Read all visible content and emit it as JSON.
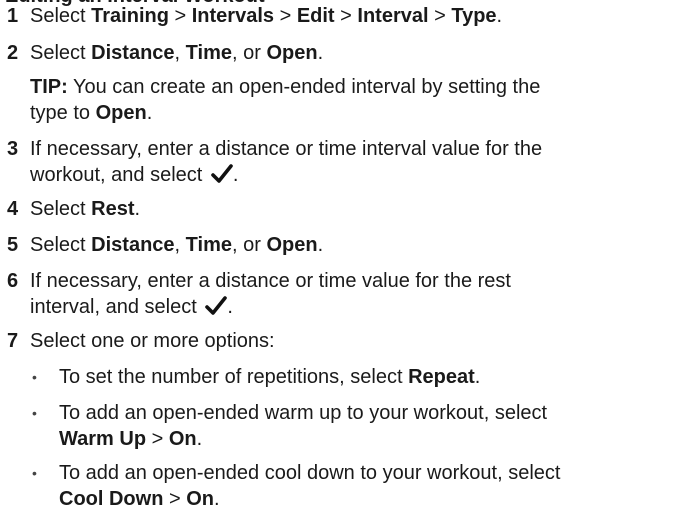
{
  "heading_partial": "Editing an Interval Workout",
  "steps": [
    {
      "num": "1",
      "lines": [
        [
          "Select ",
          {
            "b": "Training"
          },
          " > ",
          {
            "b": "Intervals"
          },
          " > ",
          {
            "b": "Edit"
          },
          " > ",
          {
            "b": "Interval"
          },
          " > ",
          {
            "b": "Type"
          },
          "."
        ]
      ]
    },
    {
      "num": "2",
      "lines": [
        [
          "Select ",
          {
            "b": "Distance"
          },
          ", ",
          {
            "b": "Time"
          },
          ", or ",
          {
            "b": "Open"
          },
          "."
        ]
      ]
    },
    {
      "num": "3",
      "lines": [
        [
          "If necessary, enter a distance or time interval value for the"
        ],
        [
          "workout, and select ",
          {
            "icon": "check"
          },
          "."
        ]
      ]
    },
    {
      "num": "4",
      "lines": [
        [
          "Select ",
          {
            "b": "Rest"
          },
          "."
        ]
      ]
    },
    {
      "num": "5",
      "lines": [
        [
          "Select ",
          {
            "b": "Distance"
          },
          ", ",
          {
            "b": "Time"
          },
          ", or ",
          {
            "b": "Open"
          },
          "."
        ]
      ]
    },
    {
      "num": "6",
      "lines": [
        [
          "If necessary, enter a distance or time value for the rest"
        ],
        [
          "interval, and select ",
          {
            "icon": "check"
          },
          "."
        ]
      ]
    },
    {
      "num": "7",
      "lines": [
        [
          "Select one or more options:"
        ]
      ]
    }
  ],
  "tip": {
    "lines": [
      [
        {
          "b": "TIP:"
        },
        " You can create an open-ended interval by setting the"
      ],
      [
        "type to ",
        {
          "b": "Open"
        },
        "."
      ]
    ]
  },
  "bullets": [
    {
      "lines": [
        [
          "To set the number of repetitions, select ",
          {
            "b": "Repeat"
          },
          "."
        ]
      ]
    },
    {
      "lines": [
        [
          "To add an open-ended warm up to your workout, select"
        ],
        [
          {
            "b": "Warm Up"
          },
          " > ",
          {
            "b": "On"
          },
          "."
        ]
      ]
    },
    {
      "lines": [
        [
          "To add an open-ended cool down to your workout, select"
        ],
        [
          {
            "b": "Cool Down"
          },
          " > ",
          {
            "b": "On"
          },
          "."
        ]
      ]
    }
  ],
  "bullet_glyph": "•",
  "icons": {
    "check": "check-icon"
  }
}
